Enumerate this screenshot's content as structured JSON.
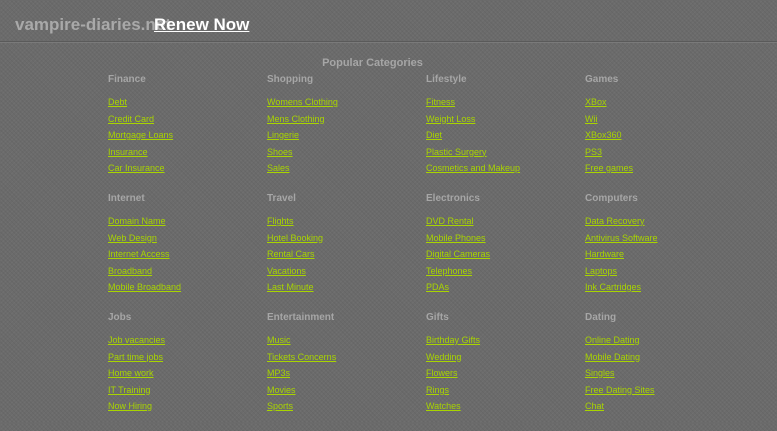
{
  "header": {
    "domain": "vampire-diaries.net",
    "renew_label": "Renew Now"
  },
  "popular_title": "Popular Categories",
  "colors": {
    "background": "#6b6b6b",
    "link": "#a8d400",
    "heading": "#a6a6a6"
  },
  "categories": [
    {
      "title": "Finance",
      "links": [
        "Debt",
        "Credit Card",
        "Mortgage Loans",
        "Insurance",
        "Car Insurance"
      ]
    },
    {
      "title": "Shopping",
      "links": [
        "Womens Clothing",
        "Mens Clothing",
        "Lingerie",
        "Shoes",
        "Sales"
      ]
    },
    {
      "title": "Lifestyle",
      "links": [
        "Fitness",
        "Weight Loss",
        "Diet",
        "Plastic Surgery",
        "Cosmetics and Makeup"
      ]
    },
    {
      "title": "Games",
      "links": [
        "XBox",
        "Wii",
        "XBox360",
        "PS3",
        "Free games"
      ]
    },
    {
      "title": "Internet",
      "links": [
        "Domain Name",
        "Web Design",
        "Internet Access",
        "Broadband",
        "Mobile Broadband"
      ]
    },
    {
      "title": "Travel",
      "links": [
        "Flights",
        "Hotel Booking",
        "Rental Cars",
        "Vacations",
        "Last Minute"
      ]
    },
    {
      "title": "Electronics",
      "links": [
        "DVD Rental",
        "Mobile Phones",
        "Digital Cameras",
        "Telephones",
        "PDAs"
      ]
    },
    {
      "title": "Computers",
      "links": [
        "Data Recovery",
        "Antivirus Software",
        "Hardware",
        "Laptops",
        "Ink Cartridges"
      ]
    },
    {
      "title": "Jobs",
      "links": [
        "Job vacancies",
        "Part time jobs",
        "Home work",
        "IT Training",
        "Now Hiring"
      ]
    },
    {
      "title": "Entertainment",
      "links": [
        "Music",
        "Tickets Concerns",
        "MP3s",
        "Movies",
        "Sports"
      ]
    },
    {
      "title": "Gifts",
      "links": [
        "Birthday Gifts",
        "Wedding",
        "Flowers",
        "Rings",
        "Watches"
      ]
    },
    {
      "title": "Dating",
      "links": [
        "Online Dating",
        "Mobile Dating",
        "Singles",
        "Free Dating Sites",
        "Chat"
      ]
    }
  ]
}
